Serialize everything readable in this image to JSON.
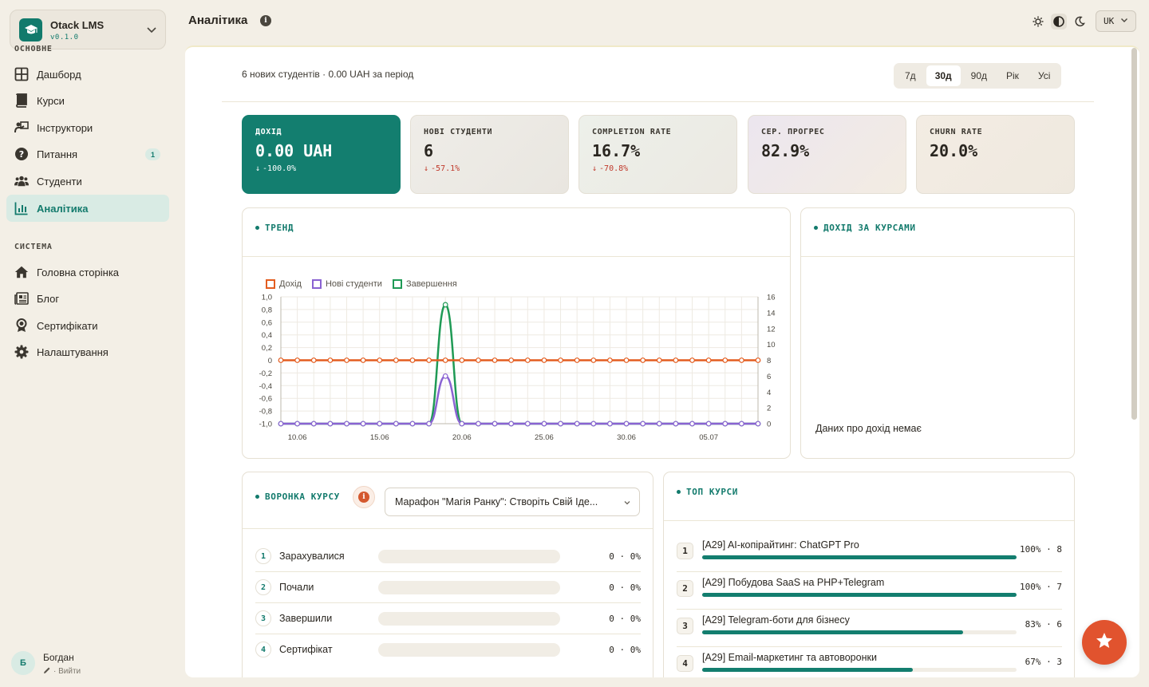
{
  "app": {
    "name": "Otack LMS",
    "version": "v0.1.0"
  },
  "sidebar": {
    "sections": [
      {
        "title": "ОСНОВНЕ",
        "items": [
          {
            "label": "Дашборд",
            "icon": "grid-icon"
          },
          {
            "label": "Курси",
            "icon": "book-icon"
          },
          {
            "label": "Інструктори",
            "icon": "presenter-icon"
          },
          {
            "label": "Питання",
            "icon": "question-icon",
            "badge": "1"
          },
          {
            "label": "Студенти",
            "icon": "users-icon"
          },
          {
            "label": "Аналітика",
            "icon": "chart-icon",
            "active": true
          }
        ]
      },
      {
        "title": "СИСТЕМА",
        "items": [
          {
            "label": "Головна сторінка",
            "icon": "home-icon"
          },
          {
            "label": "Блог",
            "icon": "newspaper-icon"
          },
          {
            "label": "Сертифікати",
            "icon": "award-icon"
          },
          {
            "label": "Налаштування",
            "icon": "gear-icon"
          }
        ]
      }
    ],
    "user": {
      "initial": "Б",
      "name": "Богдан",
      "logout": "· Вийти"
    }
  },
  "header": {
    "title": "Аналітика",
    "language": "UK",
    "theme": [
      "sun-icon",
      "contrast-icon",
      "moon-icon"
    ],
    "theme_active": 1
  },
  "summary": "6 нових студентів · 0.00 UAH за період",
  "periods": {
    "items": [
      "7д",
      "30д",
      "90д",
      "Рік",
      "Усі"
    ],
    "selected": 1
  },
  "kpis": [
    {
      "label": "ДОХІД",
      "value": "0.00 UAH",
      "change": "-100.0%"
    },
    {
      "label": "НОВІ СТУДЕНТИ",
      "value": "6",
      "change": "-57.1%"
    },
    {
      "label": "COMPLETION RATE",
      "value": "16.7%",
      "change": "-70.8%"
    },
    {
      "label": "СЕР. ПРОГРЕС",
      "value": "82.9%",
      "change": ""
    },
    {
      "label": "CHURN RATE",
      "value": "20.0%",
      "change": ""
    }
  ],
  "trend": {
    "title": "ТРЕНД"
  },
  "revenue_by_course": {
    "title": "ДОХІД ЗА КУРСАМИ",
    "empty": "Даних про дохід немає"
  },
  "chart_data": {
    "type": "line",
    "x": [
      "09.06",
      "10.06",
      "11.06",
      "12.06",
      "13.06",
      "14.06",
      "15.06",
      "16.06",
      "17.06",
      "18.06",
      "19.06",
      "20.06",
      "21.06",
      "22.06",
      "23.06",
      "24.06",
      "25.06",
      "26.06",
      "27.06",
      "28.06",
      "29.06",
      "30.06",
      "01.07",
      "02.07",
      "03.07",
      "04.07",
      "05.07",
      "06.07",
      "07.07",
      "08.07"
    ],
    "x_ticks": [
      "10.06",
      "15.06",
      "20.06",
      "25.06",
      "30.06",
      "05.07"
    ],
    "y_left": {
      "ticks": [
        "1,0",
        "0,8",
        "0,6",
        "0,4",
        "0,2",
        "0",
        "-0,2",
        "-0,4",
        "-0,6",
        "-0,8",
        "-1,0"
      ],
      "range": [
        -1,
        1
      ]
    },
    "y_right": {
      "ticks": [
        "16",
        "14",
        "12",
        "10",
        "8",
        "6",
        "4",
        "2",
        "0"
      ],
      "range": [
        0,
        16
      ]
    },
    "series": [
      {
        "name": "Дохід",
        "axis": "left",
        "color": "#e35d20",
        "values": [
          0,
          0,
          0,
          0,
          0,
          0,
          0,
          0,
          0,
          0,
          0,
          0,
          0,
          0,
          0,
          0,
          0,
          0,
          0,
          0,
          0,
          0,
          0,
          0,
          0,
          0,
          0,
          0,
          0,
          0
        ]
      },
      {
        "name": "Нові студенти",
        "axis": "right",
        "color": "#8a63d2",
        "values": [
          0,
          0,
          0,
          0,
          0,
          0,
          0,
          0,
          0,
          0,
          6,
          0,
          0,
          0,
          0,
          0,
          0,
          0,
          0,
          0,
          0,
          0,
          0,
          0,
          0,
          0,
          0,
          0,
          0,
          0
        ]
      },
      {
        "name": "Завершення",
        "axis": "right",
        "color": "#1f9a55",
        "values": [
          0,
          0,
          0,
          0,
          0,
          0,
          0,
          0,
          0,
          0,
          15,
          0,
          0,
          0,
          0,
          0,
          0,
          0,
          0,
          0,
          0,
          0,
          0,
          0,
          0,
          0,
          0,
          0,
          0,
          0
        ]
      }
    ]
  },
  "funnel": {
    "title": "ВОРОНКА КУРСУ",
    "course": "Марафон \"Магія Ранку\": Створіть Свій Іде...",
    "rows": [
      {
        "n": "1",
        "label": "Зарахувалися",
        "value": "0 · 0%"
      },
      {
        "n": "2",
        "label": "Почали",
        "value": "0 · 0%"
      },
      {
        "n": "3",
        "label": "Завершили",
        "value": "0 · 0%"
      },
      {
        "n": "4",
        "label": "Сертифікат",
        "value": "0 · 0%"
      }
    ]
  },
  "top_courses": {
    "title": "ТОП КУРСИ",
    "rows": [
      {
        "n": "1",
        "name": "[A29] AI-копірайтинг: ChatGPT Pro",
        "value": "100% · 8",
        "progress": 1.0
      },
      {
        "n": "2",
        "name": "[A29] Побудова SaaS на PHP+Telegram",
        "value": "100% · 7",
        "progress": 1.0
      },
      {
        "n": "3",
        "name": "[A29] Telegram-боти для бізнесу",
        "value": "83% · 6",
        "progress": 0.83
      },
      {
        "n": "4",
        "name": "[A29] Email-маркетинг та автоворонки",
        "value": "67% · 3",
        "progress": 0.67
      }
    ]
  },
  "colors": {
    "accent": "#137e6f",
    "fab": "#e1532e"
  }
}
